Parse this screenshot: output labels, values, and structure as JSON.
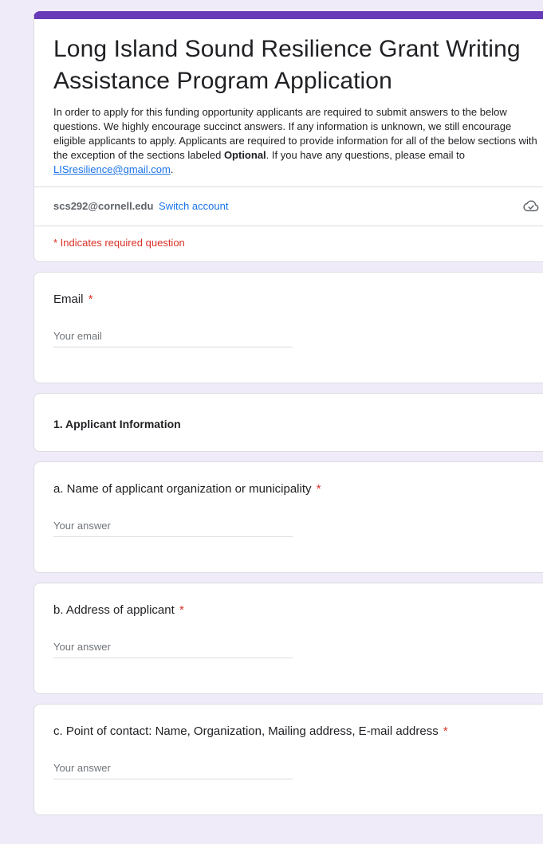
{
  "header": {
    "title": "Long Island Sound Resilience Grant Writing Assistance Program Application",
    "desc_part1": "In order to apply for this funding opportunity applicants are required to submit answers to the below questions. We highly encourage succinct answers. If any information is unknown, we still encourage eligible applicants to apply. Applicants are required to provide information for all of the below sections with the exception of the sections labeled ",
    "desc_bold": "Optional",
    "desc_part2": ". If you have any questions, please email to ",
    "desc_email_link": "LISresilience@gmail.com",
    "desc_end": ".",
    "accent_color": "#673ab7"
  },
  "account": {
    "email": "scs292@cornell.edu",
    "switch_label": "Switch account",
    "icon": "cloud-check-icon"
  },
  "required_note": "* Indicates required question",
  "questions": [
    {
      "label": "Email",
      "required_mark": "*",
      "placeholder": "Your email"
    },
    {
      "label": "a. Name of applicant organization or municipality",
      "required_mark": "*",
      "placeholder": "Your answer"
    },
    {
      "label": "b. Address of applicant",
      "required_mark": "*",
      "placeholder": "Your answer"
    },
    {
      "label": "c. Point of contact: Name, Organization, Mailing address, E-mail address",
      "required_mark": "*",
      "placeholder": "Your answer"
    }
  ],
  "sections": [
    {
      "title": "1. Applicant Information"
    }
  ]
}
